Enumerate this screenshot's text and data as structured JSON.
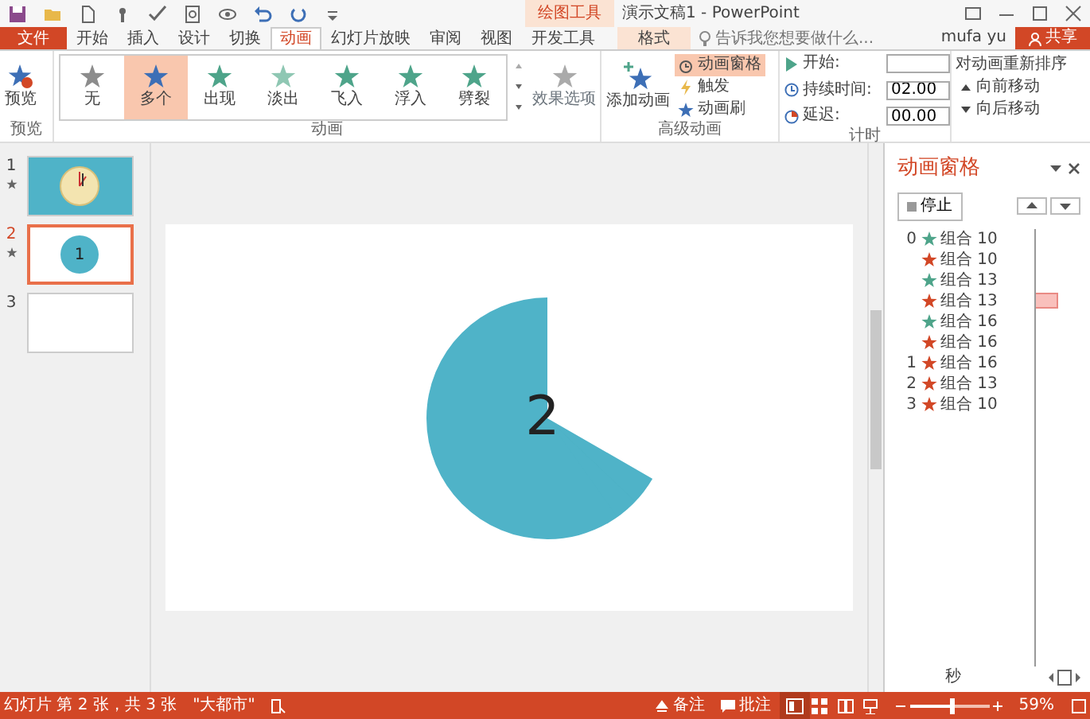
{
  "title_bar": {
    "context_label": "绘图工具",
    "title": "演示文稿1 - PowerPoint"
  },
  "tabs": [
    {
      "label": "文件",
      "kind": "file",
      "selected": false
    },
    {
      "label": "开始",
      "kind": "tab",
      "selected": false
    },
    {
      "label": "插入",
      "kind": "tab",
      "selected": false
    },
    {
      "label": "设计",
      "kind": "tab",
      "selected": false
    },
    {
      "label": "切换",
      "kind": "tab",
      "selected": false
    },
    {
      "label": "动画",
      "kind": "tab",
      "selected": true
    },
    {
      "label": "幻灯片放映",
      "kind": "tab",
      "selected": false
    },
    {
      "label": "审阅",
      "kind": "tab",
      "selected": false
    },
    {
      "label": "视图",
      "kind": "tab",
      "selected": false
    },
    {
      "label": "开发工具",
      "kind": "tab",
      "selected": false
    },
    {
      "label": "格式",
      "kind": "context",
      "selected": false
    }
  ],
  "search": {
    "placeholder": "告诉我您想要做什么..."
  },
  "user": "mufa yu",
  "share_button": "共享",
  "ribbon": {
    "preview": {
      "label": "预览",
      "group": "预览"
    },
    "gallery": {
      "group": "动画",
      "items": [
        {
          "label": "无",
          "color": "#8c8c8c",
          "selected": false
        },
        {
          "label": "多个",
          "color": "#3d6fb6",
          "selected": true
        },
        {
          "label": "出现",
          "color": "#4ea48a",
          "selected": false
        },
        {
          "label": "淡出",
          "color": "#8fc7b3",
          "selected": false
        },
        {
          "label": "飞入",
          "color": "#4ea48a",
          "selected": false
        },
        {
          "label": "浮入",
          "color": "#4ea48a",
          "selected": false
        },
        {
          "label": "劈裂",
          "color": "#4ea48a",
          "selected": false
        }
      ]
    },
    "effect_options": "效果选项",
    "advanced": {
      "add_animation": "添加动画",
      "group": "高级动画",
      "items": [
        {
          "label": "动画窗格",
          "selected": true
        },
        {
          "label": "触发",
          "selected": false
        },
        {
          "label": "动画刷",
          "selected": false
        }
      ]
    },
    "timing": {
      "start_label": "开始:",
      "duration_label": "持续时间:",
      "duration": "02.00",
      "delay_label": "延迟:",
      "delay": "00.00",
      "group": "计时"
    },
    "reorder": {
      "title": "对动画重新排序",
      "earlier": "向前移动",
      "later": "向后移动"
    }
  },
  "slides": [
    {
      "number": "1",
      "kind": "clock",
      "selected": false
    },
    {
      "number": "2",
      "kind": "circle",
      "circle_text": "1",
      "selected": true
    },
    {
      "number": "3",
      "kind": "blank",
      "selected": false
    }
  ],
  "slide": {
    "text": "2"
  },
  "animation_pane": {
    "title": "动画窗格",
    "stop_button": "停止",
    "time_unit": "秒",
    "items": [
      {
        "index": "0",
        "color": "#4ea48a",
        "label": "组合 10",
        "bar": false
      },
      {
        "color": "#d24726",
        "label": "组合 10",
        "bar": false
      },
      {
        "color": "#4ea48a",
        "label": "组合 13",
        "bar": false
      },
      {
        "color": "#d24726",
        "label": "组合 13",
        "bar": true
      },
      {
        "color": "#4ea48a",
        "label": "组合 16",
        "bar": false
      },
      {
        "color": "#d24726",
        "label": "组合 16",
        "bar": false
      },
      {
        "index": "1",
        "color": "#d24726",
        "label": "组合 16",
        "bar": false
      },
      {
        "index": "2",
        "color": "#d24726",
        "label": "组合 13",
        "bar": false
      },
      {
        "index": "3",
        "color": "#d24726",
        "label": "组合 10",
        "bar": false
      }
    ]
  },
  "status_bar": {
    "slide_info": "幻灯片 第 2 张，共 3 张",
    "theme": "\"大都市\"",
    "notes": "备注",
    "comments": "批注",
    "zoom": "59%",
    "zoom_slider": {
      "level": 0.5
    }
  }
}
